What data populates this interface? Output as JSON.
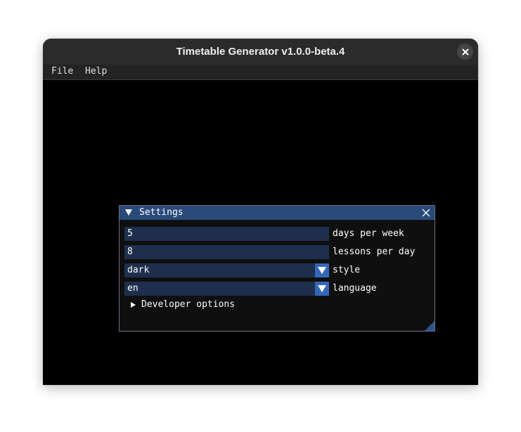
{
  "window": {
    "title": "Timetable Generator v1.0.0-beta.4"
  },
  "menu": {
    "file": "File",
    "help": "Help"
  },
  "settings": {
    "title": "Settings",
    "fields": [
      {
        "value": "5",
        "label": "days per week"
      },
      {
        "value": "8",
        "label": "lessons per day"
      },
      {
        "value": "dark",
        "label": "style"
      },
      {
        "value": "en",
        "label": "language"
      }
    ],
    "developer_options": "Developer options"
  },
  "colors": {
    "title_bar": "#294a7a",
    "field_bg": "#1d2f4c",
    "combo_button": "#3368b8"
  }
}
